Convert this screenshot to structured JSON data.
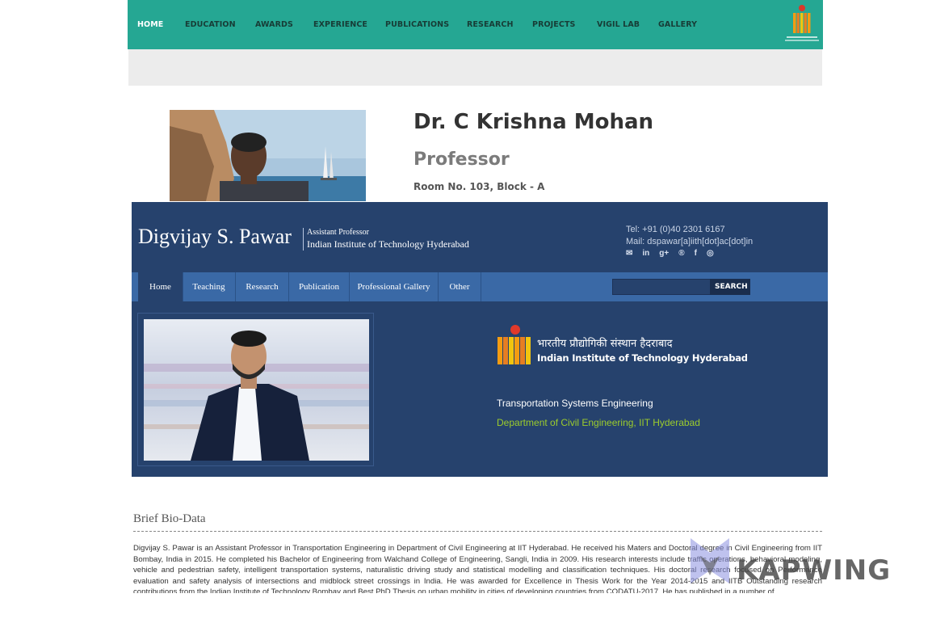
{
  "page1": {
    "nav": [
      "HOME",
      "EDUCATION",
      "AWARDS",
      "EXPERIENCE",
      "PUBLICATIONS",
      "RESEARCH",
      "PROJECTS",
      "VIGIL LAB",
      "GALLERY"
    ],
    "name": "Dr. C Krishna Mohan",
    "designation": "Professor",
    "room": "Room No. 103, Block - A"
  },
  "page2": {
    "name": "Digvijay S. Pawar",
    "role": "Assistant Professor",
    "institute": "Indian Institute of Technology Hyderabad",
    "tel": "Tel: +91 (0)40 2301 6167",
    "mail": "Mail: dspawar[a]iith[dot]ac[dot]in",
    "social": [
      "✉",
      "in",
      "g+",
      "®",
      "f",
      "◎"
    ],
    "tabs": [
      "Home",
      "Teaching",
      "Research",
      "Publication",
      "Professional Gallery",
      "Other"
    ],
    "search": {
      "placeholder": "",
      "button": "SEARCH"
    },
    "logo": {
      "hindi": "भारतीय प्रौद्योगिकी संस्थान हैदराबाद",
      "english": "Indian Institute of Technology Hyderabad"
    },
    "area": "Transportation Systems Engineering",
    "department": "Department of Civil Engineering, IIT Hyderabad",
    "bio_heading": "Brief Bio-Data",
    "bio_text": "Digvijay S. Pawar is an Assistant Professor in Transportation Engineering in Department of Civil Engineering at IIT Hyderabad. He received his Maters and Doctoral degree in Civil Engineering from IIT Bombay, India in 2015. He completed his Bachelor of Engineering from Walchand College of Engineering, Sangli, India in 2009. His research interests include traffic operations, behavioral modeling, vehicle and pedestrian safety, intelligent transportation systems, naturalistic driving study and statistical modelling and classification techniques. His doctoral research focused on Performance evaluation and safety analysis of intersections and midblock street crossings in India. He was awarded for Excellence in Thesis Work for the Year 2014-2015 and IITB Outstanding research contributions from the Indian Institute of Technology Bombay and Best PhD Thesis on urban mobility in cities of developing countries from CODATU-2017. He has published in a number of"
  },
  "watermark": "KAPWING",
  "colors": {
    "top_nav": "#25a793",
    "header_blue": "#26426d",
    "nav_blue": "#3a69a6",
    "dept_green": "#9ccc2c"
  }
}
